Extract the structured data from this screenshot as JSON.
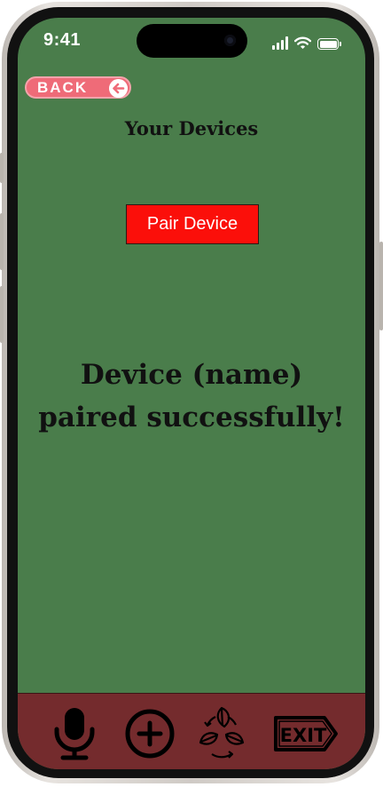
{
  "status_bar": {
    "time": "9:41",
    "icons": [
      "signal-icon",
      "wifi-icon",
      "battery-icon"
    ]
  },
  "header": {
    "back_label": "BACK",
    "back_icon": "arrow-left-icon",
    "title": "Your Devices"
  },
  "main": {
    "pair_button_label": "Pair Device",
    "success_message": "Device (name) paired successfully!"
  },
  "bottom_nav": {
    "items": [
      {
        "icon": "microphone-icon"
      },
      {
        "icon": "plus-circle-icon"
      },
      {
        "icon": "recycle-leaves-icon"
      },
      {
        "icon": "exit-sign-icon",
        "label": "EXIT"
      }
    ]
  },
  "colors": {
    "screen_background": "#4a7d4b",
    "bottom_bar": "#742b2d",
    "pair_button": "#fb0f0a",
    "back_button": "#ef6b78"
  }
}
